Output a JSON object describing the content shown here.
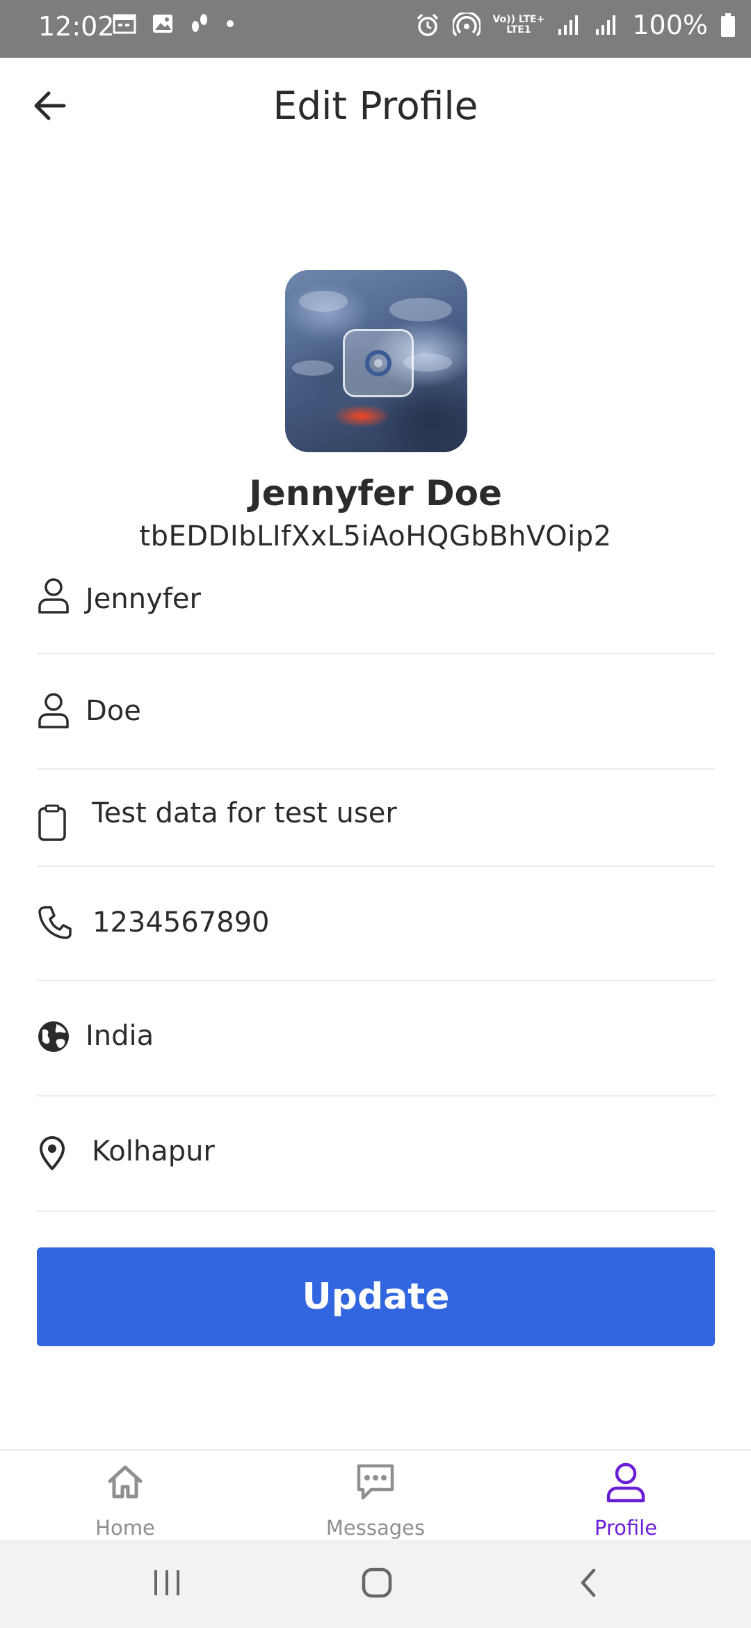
{
  "status_bar": {
    "time": "12:02",
    "battery_text": "100%",
    "network_top": "Vo)) LTE+",
    "network_bottom": "LTE1"
  },
  "header": {
    "title": "Edit Profile"
  },
  "profile": {
    "full_name": "Jennyfer Doe",
    "user_id": "tbEDDIbLIfXxL5iAoHQGbBhVOip2"
  },
  "fields": {
    "first_name": "Jennyfer",
    "last_name": "Doe",
    "bio": "Test data for test user",
    "phone": "1234567890",
    "country": "India",
    "city": "Kolhapur"
  },
  "actions": {
    "update_label": "Update"
  },
  "bottom_nav": {
    "items": [
      {
        "label": "Home",
        "icon": "home-icon"
      },
      {
        "label": "Messages",
        "icon": "chat-bubble-icon"
      },
      {
        "label": "Profile",
        "icon": "person-icon"
      }
    ],
    "active": "Profile"
  },
  "colors": {
    "primary_button": "#3166e0",
    "active_nav": "#6a1fd6",
    "status_bar": "#7d7d7d"
  }
}
